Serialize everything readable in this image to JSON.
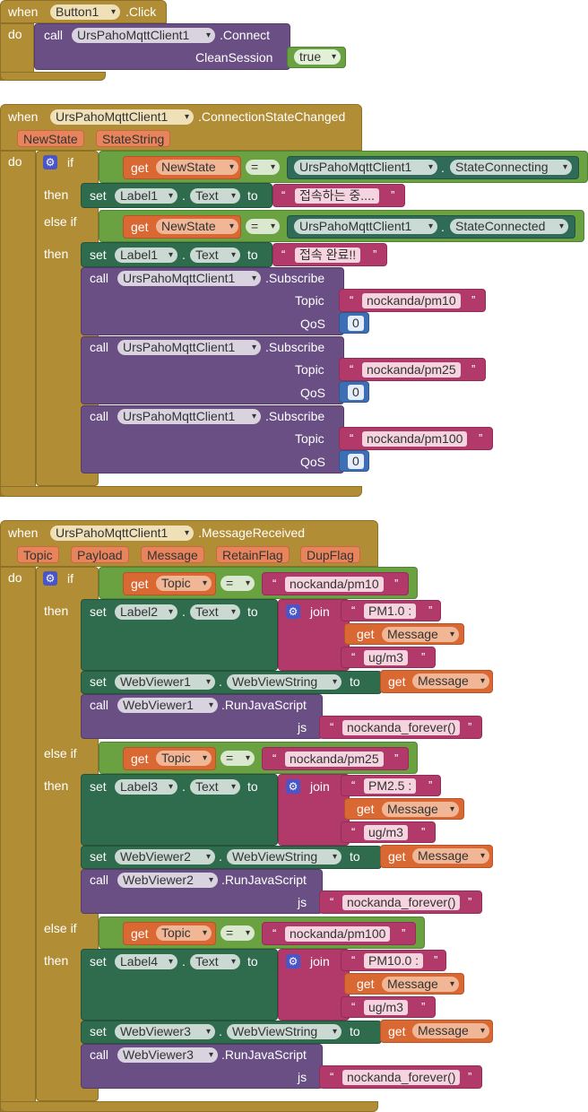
{
  "kw": {
    "when": "when",
    "do": "do",
    "call": "call",
    "set": "set",
    "get": "get",
    "to": "to",
    "if": "if",
    "then": "then",
    "else_if": "else if",
    "join": "join",
    "eq": "=",
    "dot": ".",
    "open_q": "“",
    "close_q": "”"
  },
  "block1": {
    "component": "Button1",
    "event": ".Click",
    "client": "UrsPahoMqttClient1",
    "method": ".Connect",
    "arg_label": "CleanSession",
    "arg_value": "true"
  },
  "block2": {
    "component": "UrsPahoMqttClient1",
    "event": ".ConnectionStateChanged",
    "params": [
      "NewState",
      "StateString"
    ],
    "if1": {
      "var": "NewState",
      "rhs_comp": "UrsPahoMqttClient1",
      "rhs_prop": "StateConnecting"
    },
    "then1": {
      "comp": "Label1",
      "prop": "Text",
      "value": "접속하는 중...."
    },
    "if2": {
      "var": "NewState",
      "rhs_comp": "UrsPahoMqttClient1",
      "rhs_prop": "StateConnected"
    },
    "then2": {
      "comp": "Label1",
      "prop": "Text",
      "value": "접속 완료!!"
    },
    "subscribe": {
      "comp": "UrsPahoMqttClient1",
      "method": ".Subscribe",
      "topic_label": "Topic",
      "qos_label": "QoS"
    },
    "topics": [
      "nockanda/pm10",
      "nockanda/pm25",
      "nockanda/pm100"
    ],
    "qos": [
      "0",
      "0",
      "0"
    ]
  },
  "block3": {
    "component": "UrsPahoMqttClient1",
    "event": ".MessageReceived",
    "params": [
      "Topic",
      "Payload",
      "Message",
      "RetainFlag",
      "DupFlag"
    ],
    "branches": [
      {
        "cond_var": "Topic",
        "cond_val": "nockanda/pm10",
        "label": "Label2",
        "prefix": "PM1.0 : ",
        "suffix": "ug/m3",
        "viewer": "WebViewer1"
      },
      {
        "cond_var": "Topic",
        "cond_val": "nockanda/pm25",
        "label": "Label3",
        "prefix": "PM2.5 : ",
        "suffix": "ug/m3",
        "viewer": "WebViewer2"
      },
      {
        "cond_var": "Topic",
        "cond_val": "nockanda/pm100",
        "label": "Label4",
        "prefix": "PM10.0 : ",
        "suffix": "ug/m3",
        "viewer": "WebViewer3"
      }
    ],
    "text_prop": "Text",
    "webview_prop": "WebViewString",
    "msg_var": "Message",
    "run_method": ".RunJavaScript",
    "js_label": "js",
    "js_value": "nockanda_forever()"
  },
  "colors": {
    "event": "#b18e35",
    "call": "#6a4f84",
    "set": "#2f6b4d",
    "compare": "#6aa241",
    "get": "#d96832",
    "text": "#b23a6b",
    "number": "#3e6fb5"
  }
}
